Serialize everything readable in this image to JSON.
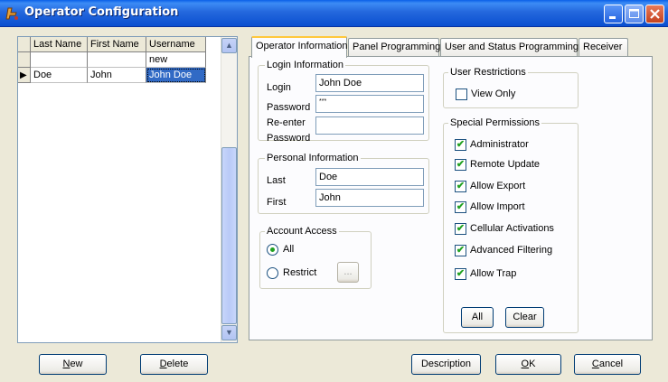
{
  "window": {
    "title": "Operator Configuration",
    "icons": {
      "app": "app-logo-icon",
      "minimize": "minimize-icon",
      "maximize": "maximize-icon",
      "close": "close-icon"
    }
  },
  "grid": {
    "columns": [
      "Last Name",
      "First Name",
      "Username"
    ],
    "rows": [
      {
        "last": "",
        "first": "",
        "user": "new",
        "current": false
      },
      {
        "last": "Doe",
        "first": "John",
        "user": "John Doe",
        "current": true
      }
    ],
    "row_indicator": "▶",
    "scroll_up": "▲",
    "scroll_down": "▼"
  },
  "tabs": [
    {
      "label": "Operator Information",
      "active": true
    },
    {
      "label": "Panel Programming",
      "active": false
    },
    {
      "label": "User and Status Programming",
      "active": false
    },
    {
      "label": "Receiver",
      "active": false
    }
  ],
  "login": {
    "group_label": "Login Information",
    "login_label": "Login",
    "login_value": "John Doe",
    "password_label": "Password",
    "password_value": "***",
    "reenter_label_1": "Re-enter",
    "reenter_label_2": "Password",
    "reenter_value": ""
  },
  "personal": {
    "group_label": "Personal Information",
    "last_label": "Last",
    "last_value": "Doe",
    "first_label": "First",
    "first_value": "John"
  },
  "account_access": {
    "group_label": "Account Access",
    "all_label": "All",
    "restrict_label": "Restrict",
    "selected": "All",
    "browse_label": "..."
  },
  "user_restrictions": {
    "group_label": "User Restrictions",
    "items": [
      {
        "label": "View Only",
        "checked": false
      }
    ]
  },
  "special_permissions": {
    "group_label": "Special Permissions",
    "items": [
      {
        "label": "Administrator",
        "checked": true
      },
      {
        "label": "Remote Update",
        "checked": true
      },
      {
        "label": "Allow Export",
        "checked": true
      },
      {
        "label": "Allow Import",
        "checked": true
      },
      {
        "label": "Cellular Activations",
        "checked": true
      },
      {
        "label": "Advanced Filtering",
        "checked": true
      },
      {
        "label": "Allow Trap",
        "checked": true
      }
    ],
    "all_button": "All",
    "clear_button": "Clear"
  },
  "footer": {
    "new_button": {
      "label": "New",
      "mnemonic": "N",
      "rest": "ew"
    },
    "delete_button": {
      "label": "Delete",
      "mnemonic": "D",
      "rest": "elete"
    },
    "description_button": "Description",
    "ok_button": {
      "label": "OK",
      "mnemonic": "O",
      "rest": "K"
    },
    "cancel_button": {
      "label": "Cancel",
      "mnemonic": "C",
      "rest": "ancel"
    }
  },
  "colors": {
    "titlebar": "#0A5FE8",
    "selection": "#316AC5",
    "dialog": "#ECE9D8",
    "checkmark": "#21A121"
  }
}
